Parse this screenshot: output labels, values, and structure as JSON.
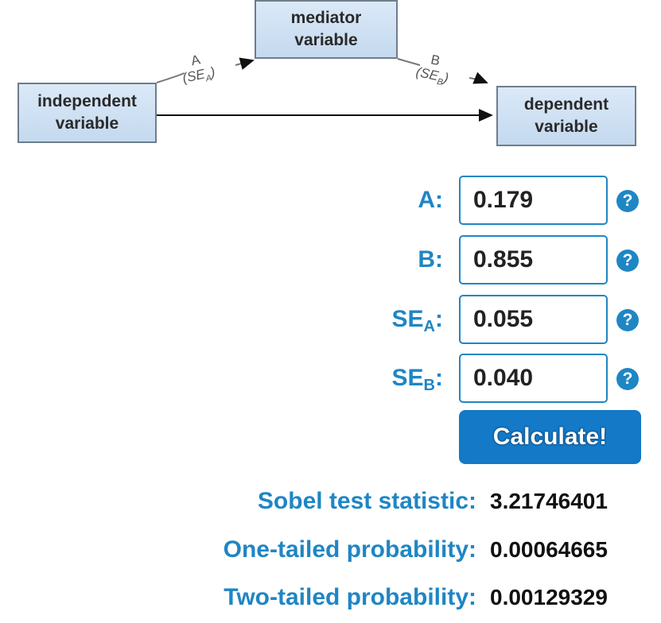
{
  "diagram": {
    "independent": [
      "independent",
      "variable"
    ],
    "mediator": [
      "mediator",
      "variable"
    ],
    "dependent": [
      "dependent",
      "variable"
    ],
    "path_a": {
      "name": "A",
      "se_prefix": "(SE",
      "se_sub": "A",
      "se_suffix": ")"
    },
    "path_b": {
      "name": "B",
      "se_prefix": "(SE",
      "se_sub": "B",
      "se_suffix": ")"
    }
  },
  "form": {
    "a": {
      "label": "A:",
      "value": "0.179"
    },
    "b": {
      "label": "B:",
      "value": "0.855"
    },
    "se_a": {
      "label_main": "SE",
      "label_sub": "A",
      "label_colon": ":",
      "value": "0.055"
    },
    "se_b": {
      "label_main": "SE",
      "label_sub": "B",
      "label_colon": ":",
      "value": "0.040"
    },
    "help_glyph": "?",
    "help_icon": "question-circle-icon",
    "calculate_label": "Calculate!"
  },
  "results": {
    "sobel": {
      "label": "Sobel test statistic:",
      "value": "3.21746401"
    },
    "one_tailed": {
      "label": "One-tailed probability:",
      "value": "0.00064665"
    },
    "two_tailed": {
      "label": "Two-tailed probability:",
      "value": "0.00129329"
    }
  },
  "colors": {
    "accent": "#1f86c4",
    "button": "#1479c6",
    "box_fill": "#c4d9ef",
    "box_border": "#6f7d8c"
  }
}
